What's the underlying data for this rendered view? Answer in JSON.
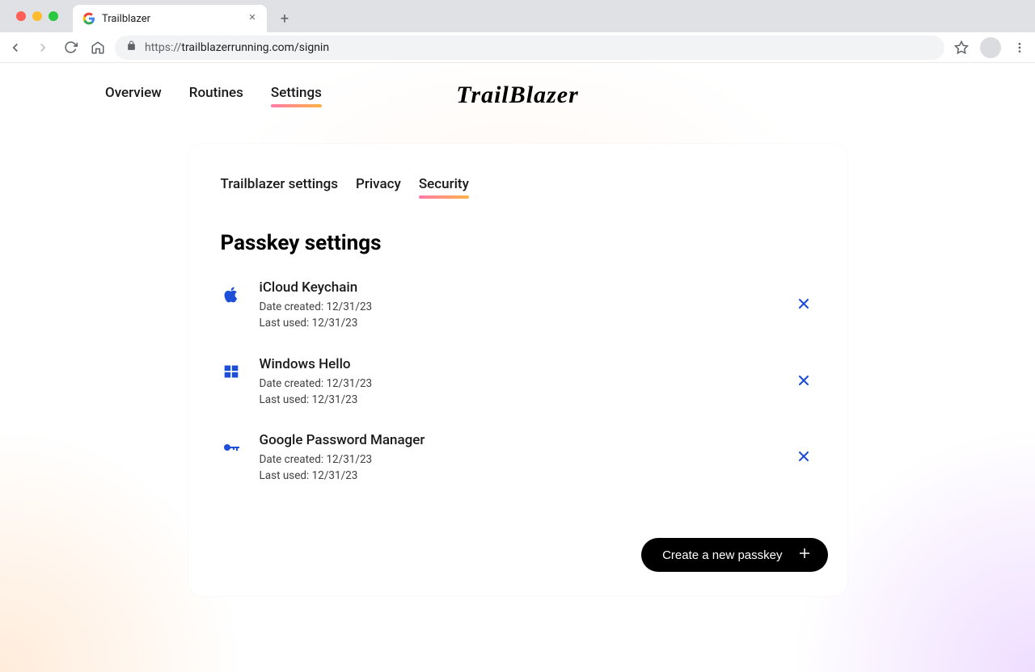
{
  "browser": {
    "tab_title": "Trailblazer",
    "url_display": "https://trailblazerrunning.com/signin",
    "url_proto": "https://",
    "url_rest": "trailblazerrunning.com/signin"
  },
  "nav": {
    "items": [
      {
        "label": "Overview",
        "active": false
      },
      {
        "label": "Routines",
        "active": false
      },
      {
        "label": "Settings",
        "active": true
      }
    ],
    "brand": "TrailBlazer"
  },
  "subtabs": [
    {
      "label": "Trailblazer settings",
      "active": false
    },
    {
      "label": "Privacy",
      "active": false
    },
    {
      "label": "Security",
      "active": true
    }
  ],
  "section_title": "Passkey settings",
  "passkeys": [
    {
      "name": "iCloud Keychain",
      "created": "Date created: 12/31/23",
      "used": "Last used: 12/31/23",
      "icon": "apple"
    },
    {
      "name": "Windows Hello",
      "created": "Date created: 12/31/23",
      "used": "Last used: 12/31/23",
      "icon": "windows"
    },
    {
      "name": "Google Password Manager",
      "created": "Date created: 12/31/23",
      "used": "Last used: 12/31/23",
      "icon": "key"
    }
  ],
  "create_button": "Create a new passkey"
}
